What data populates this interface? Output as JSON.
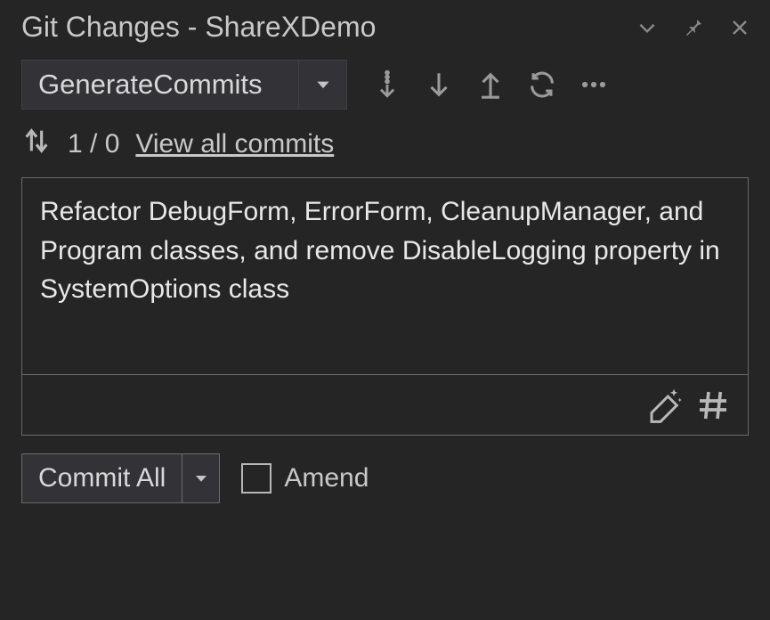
{
  "titlebar": {
    "title": "Git Changes - ShareXDemo"
  },
  "branch": {
    "name": "GenerateCommits"
  },
  "status": {
    "counts": "1 / 0",
    "link_label": "View all commits"
  },
  "commit_message": "Refactor DebugForm, ErrorForm, CleanupManager, and Program classes, and remove DisableLogging property in SystemOptions class",
  "commit_button": {
    "label": "Commit All"
  },
  "amend": {
    "label": "Amend",
    "checked": false
  }
}
